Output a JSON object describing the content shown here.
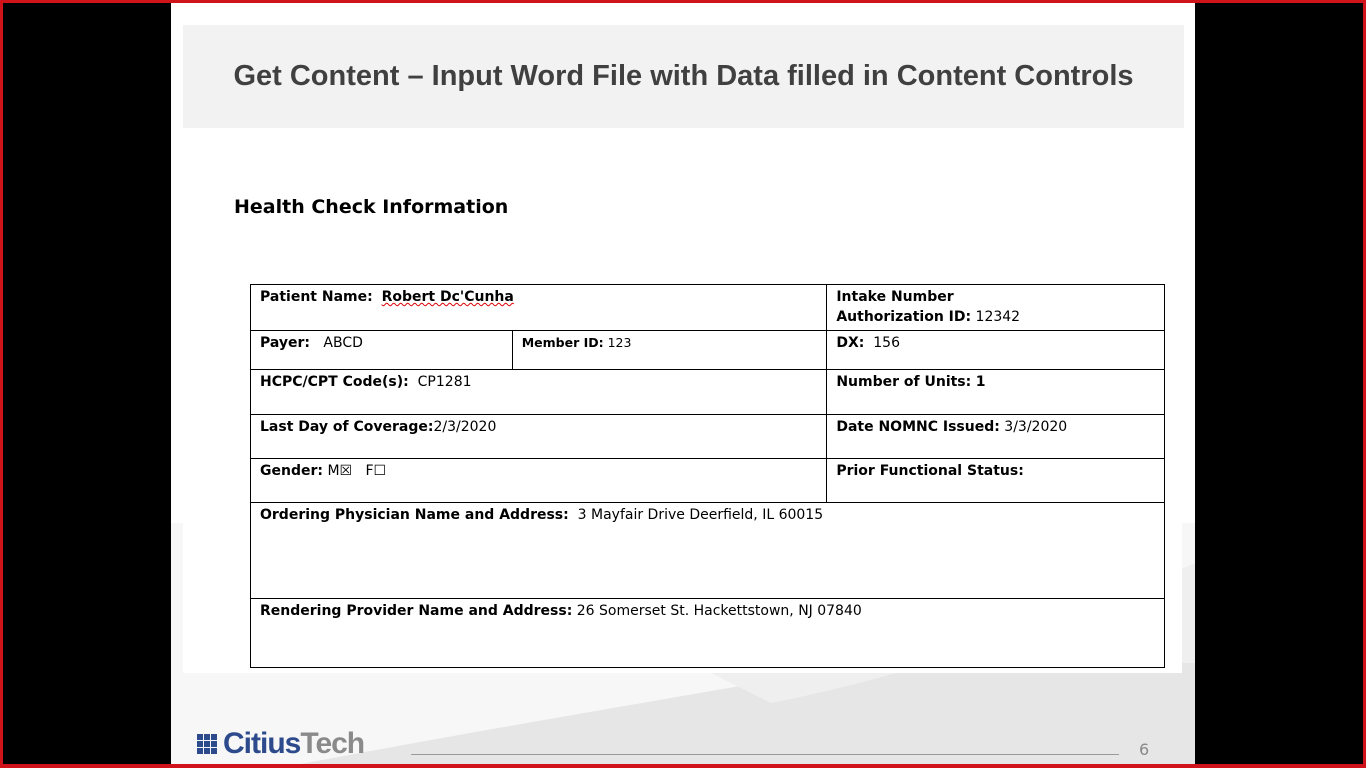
{
  "slide": {
    "title": "Get Content – Input Word File with Data filled in Content Controls",
    "page_number": "6",
    "logo": "CitiusTech"
  },
  "document": {
    "heading": "Health Check Information",
    "patient_name_label": "Patient Name:",
    "patient_name": "Robert Dc'Cunha",
    "intake_label": "Intake Number",
    "auth_label": "Authorization ID:",
    "auth_value": "12342",
    "payer_label": "Payer:",
    "payer_value": "ABCD",
    "member_label": "Member ID:",
    "member_value": "123",
    "dx_label": "DX:",
    "dx_value": "156",
    "hcpc_label": "HCPC/CPT Code(s):",
    "hcpc_value": "CP1281",
    "units_label": "Number of Units:",
    "units_value": "1",
    "coverage_label": "Last Day of Coverage:",
    "coverage_value": "2/3/2020",
    "nomnc_label": "Date NOMNC Issued:",
    "nomnc_value": "3/3/2020",
    "gender_label": "Gender:",
    "gender_m": "M",
    "gender_m_box": "☒",
    "gender_f": "F",
    "gender_f_box": "☐",
    "prior_label": "Prior Functional Status:",
    "ordering_label": "Ordering Physician Name and Address:",
    "ordering_value": "3 Mayfair Drive Deerfield, IL 60015",
    "rendering_label": "Rendering Provider Name and Address:",
    "rendering_value": "26 Somerset St.  Hackettstown, NJ 07840"
  }
}
